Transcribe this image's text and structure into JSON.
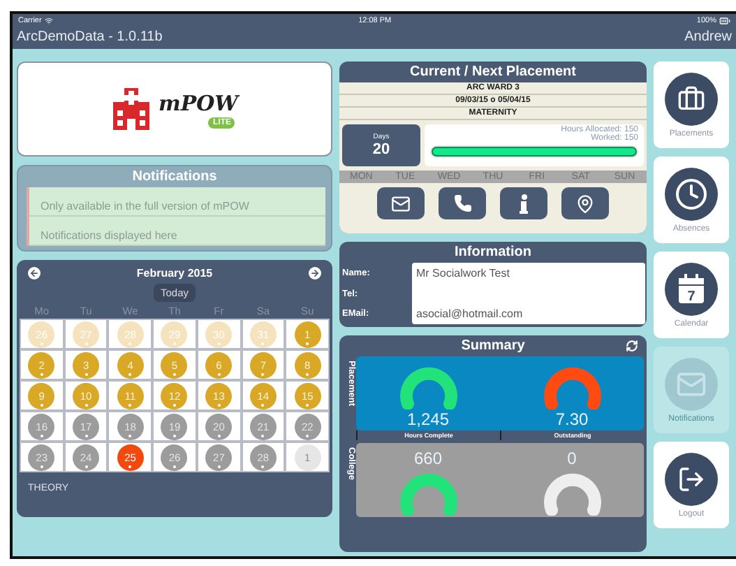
{
  "status_bar": {
    "carrier": "Carrier",
    "time": "12:08 PM",
    "battery": "100%"
  },
  "title_bar": {
    "title": "ArcDemoData - 1.0.11b",
    "user": "Andrew"
  },
  "logo": {
    "name": "mPOW",
    "badge": "LITE"
  },
  "notifications": {
    "title": "Notifications",
    "lines": [
      "Only available in the full version of mPOW",
      "Notifications displayed here"
    ]
  },
  "calendar": {
    "month": "February 2015",
    "today_button": "Today",
    "weekdays": [
      "Mo",
      "Tu",
      "We",
      "Th",
      "Fr",
      "Sa",
      "Su"
    ],
    "days": [
      {
        "label": "26",
        "kind": "other"
      },
      {
        "label": "27",
        "kind": "other"
      },
      {
        "label": "28",
        "kind": "other"
      },
      {
        "label": "29",
        "kind": "other"
      },
      {
        "label": "30",
        "kind": "other"
      },
      {
        "label": "31",
        "kind": "other"
      },
      {
        "label": "1",
        "kind": "gold"
      },
      {
        "label": "2",
        "kind": "gold"
      },
      {
        "label": "3",
        "kind": "gold"
      },
      {
        "label": "4",
        "kind": "gold"
      },
      {
        "label": "5",
        "kind": "gold"
      },
      {
        "label": "6",
        "kind": "gold"
      },
      {
        "label": "7",
        "kind": "gold"
      },
      {
        "label": "8",
        "kind": "gold"
      },
      {
        "label": "9",
        "kind": "gold"
      },
      {
        "label": "10",
        "kind": "gold"
      },
      {
        "label": "11",
        "kind": "gold"
      },
      {
        "label": "12",
        "kind": "gold"
      },
      {
        "label": "13",
        "kind": "gold"
      },
      {
        "label": "14",
        "kind": "gold"
      },
      {
        "label": "15",
        "kind": "gold"
      },
      {
        "label": "16",
        "kind": "grey"
      },
      {
        "label": "17",
        "kind": "grey"
      },
      {
        "label": "18",
        "kind": "grey"
      },
      {
        "label": "19",
        "kind": "grey"
      },
      {
        "label": "20",
        "kind": "grey"
      },
      {
        "label": "21",
        "kind": "grey"
      },
      {
        "label": "22",
        "kind": "grey"
      },
      {
        "label": "23",
        "kind": "grey"
      },
      {
        "label": "24",
        "kind": "grey"
      },
      {
        "label": "25",
        "kind": "today"
      },
      {
        "label": "26",
        "kind": "grey"
      },
      {
        "label": "27",
        "kind": "grey"
      },
      {
        "label": "28",
        "kind": "grey"
      },
      {
        "label": "1",
        "kind": "next"
      }
    ],
    "footer": "THEORY"
  },
  "placement": {
    "title": "Current / Next Placement",
    "ward": "ARC WARD 3",
    "dates": "09/03/15 o 05/04/15",
    "specialty": "MATERNITY",
    "days_label": "Days",
    "days": "20",
    "hours_allocated": "Hours Allocated: 150",
    "worked": "Worked: 150",
    "level": 1,
    "weekdays": [
      "MON",
      "TUE",
      "WED",
      "THU",
      "FRI",
      "SAT",
      "SUN"
    ],
    "actions": [
      {
        "kind": "mail"
      },
      {
        "kind": "phone"
      },
      {
        "kind": "info"
      },
      {
        "kind": "pin"
      }
    ]
  },
  "information": {
    "title": "Information",
    "fields": [
      {
        "label": "Name:",
        "value": "Mr Socialwork Test"
      },
      {
        "label": "Tel:"
      },
      {
        "label": "EMail:",
        "value": "asocial@hotmail.com"
      }
    ]
  },
  "summary": {
    "title": "Summary",
    "rows": [
      {
        "title": "Placement",
        "kind": "placement",
        "gauges": [
          {
            "value": "1,245",
            "label": "Hours Complete",
            "color": "#22e27a"
          },
          {
            "value": "7.30",
            "label": "Outstanding",
            "color": "#ff4a12"
          }
        ]
      },
      {
        "title": "College",
        "kind": "college",
        "gauges": [
          {
            "value": "660",
            "color": "#22e27a"
          },
          {
            "value": "0",
            "color": "#eeeeee"
          }
        ]
      }
    ]
  },
  "nav": [
    {
      "label": "Placements",
      "kind": "briefcase",
      "disabled": false
    },
    {
      "label": "Absences",
      "kind": "clock",
      "disabled": false
    },
    {
      "label": "Calendar",
      "kind": "calendar",
      "icon_text": "7",
      "disabled": false
    },
    {
      "label": "Notifications",
      "kind": "mail",
      "disabled": true
    },
    {
      "label": "Logout",
      "kind": "logout",
      "disabled": false
    }
  ]
}
